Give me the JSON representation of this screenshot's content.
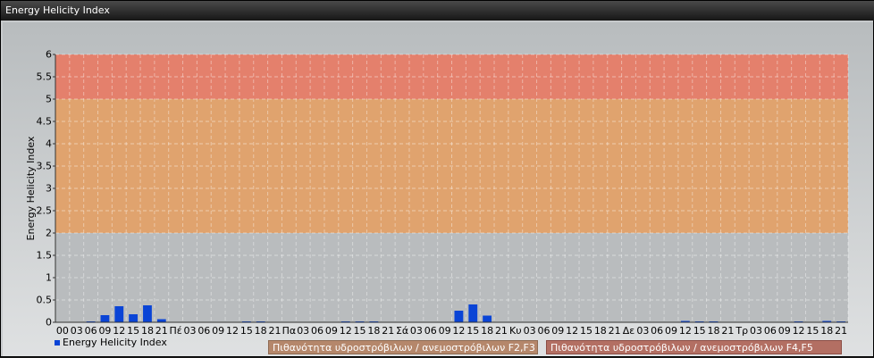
{
  "window": {
    "title": "Energy Helicity Index"
  },
  "legend": {
    "series_label": "Energy Helicity Index",
    "band_f2_f3": "Πιθανότητα υδροστρόβιλων / ανεμοστρόβιλων F2,F3",
    "band_f4_f5": "Πιθανότητα υδροστρόβιλων / ανεμοστρόβιλων F4,F5"
  },
  "colors": {
    "series": "#0a44d6",
    "band_low": "#e0a36e",
    "band_high": "#e4806c"
  },
  "chart_data": {
    "type": "bar",
    "title": "",
    "xlabel": "",
    "ylabel": "Energy Helicity Index",
    "ylim": [
      0,
      6
    ],
    "yticks": [
      "0",
      "0.5",
      "1",
      "1.5",
      "2",
      "2.5",
      "3",
      "3.5",
      "4",
      "4.5",
      "5",
      "5.5",
      "6"
    ],
    "grid": true,
    "legend_position": "bottom-left",
    "bands": [
      {
        "from": 2,
        "to": 5,
        "color": "#e0a36e"
      },
      {
        "from": 5,
        "to": 6,
        "color": "#e4806c"
      }
    ],
    "categories": [
      "00",
      "03",
      "06",
      "09",
      "12",
      "15",
      "18",
      "21",
      "Πέ",
      "03",
      "06",
      "09",
      "12",
      "15",
      "18",
      "21",
      "Πα",
      "03",
      "06",
      "09",
      "12",
      "15",
      "18",
      "21",
      "Σά",
      "03",
      "06",
      "09",
      "12",
      "15",
      "18",
      "21",
      "Κυ",
      "03",
      "06",
      "09",
      "12",
      "15",
      "18",
      "21",
      "Δε",
      "03",
      "06",
      "09",
      "12",
      "15",
      "18",
      "21",
      "Τρ",
      "03",
      "06",
      "09",
      "12",
      "15",
      "18",
      "21"
    ],
    "series": [
      {
        "name": "Energy Helicity Index",
        "values": [
          0.01,
          0.01,
          0.02,
          0.16,
          0.36,
          0.18,
          0.38,
          0.07,
          0.01,
          0.01,
          0.01,
          0.01,
          0.01,
          0.02,
          0.02,
          0.01,
          0.01,
          0.01,
          0.01,
          0.01,
          0.02,
          0.02,
          0.02,
          0.01,
          0.01,
          0.01,
          0.01,
          0.01,
          0.26,
          0.4,
          0.15,
          0.01,
          0.01,
          0.01,
          0.01,
          0.01,
          0.01,
          0.01,
          0.01,
          0.01,
          0.01,
          0.01,
          0.01,
          0.01,
          0.03,
          0.02,
          0.02,
          0.01,
          0.01,
          0.01,
          0.01,
          0.01,
          0.02,
          0.01,
          0.03,
          0.02
        ]
      }
    ]
  }
}
